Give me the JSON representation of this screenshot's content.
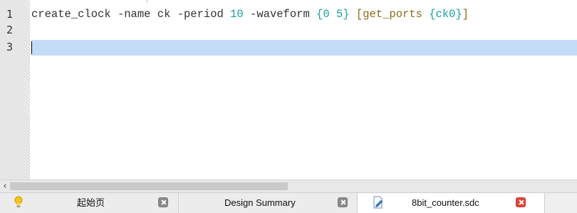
{
  "editor": {
    "line_numbers": [
      "1",
      "2",
      "3"
    ],
    "lines": {
      "l1": {
        "cmd": "create_clock",
        "name_flag": "-name",
        "name_val": "ck",
        "period_flag": "-period",
        "period_val": "10",
        "wave_flag": "-waveform",
        "wave_val": "{0 5}",
        "br_open": "[",
        "get_ports": "get_ports",
        "ports_val": "{ck0}",
        "br_close": "]"
      },
      "l2": "",
      "l3": ""
    },
    "current_line": 3,
    "current_line_color": "#c4dcf8"
  },
  "scrollbar": {
    "left_arrow": "‹"
  },
  "tabs": [
    {
      "label": "起始页",
      "icon": "lightbulb-icon",
      "active": false
    },
    {
      "label": "Design Summary",
      "active": false
    },
    {
      "label": "8bit_counter.sdc",
      "icon": "file-edit-icon",
      "active": true,
      "close_color": "#e0473b"
    }
  ]
}
